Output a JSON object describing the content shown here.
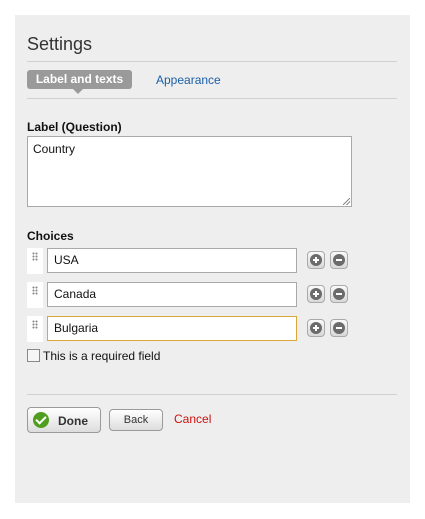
{
  "panel": {
    "title": "Settings"
  },
  "tabs": {
    "active_label": "Label and texts",
    "other_label": "Appearance"
  },
  "label_field": {
    "label": "Label (Question)",
    "value": "Country"
  },
  "choices": {
    "label": "Choices",
    "items": [
      {
        "value": "USA"
      },
      {
        "value": "Canada"
      },
      {
        "value": "Bulgaria"
      }
    ]
  },
  "required": {
    "label": "This is a required field",
    "checked": false
  },
  "actions": {
    "done_label": "Done",
    "back_label": "Back",
    "cancel_label": "Cancel"
  },
  "colors": {
    "panel_bg": "#eeeeee",
    "tab_active_bg": "#9a9a9a",
    "link_blue": "#1a5fa8",
    "cancel_red": "#cc1111",
    "done_icon_green": "#4f9e1f",
    "focus_border": "#d9a83a"
  }
}
